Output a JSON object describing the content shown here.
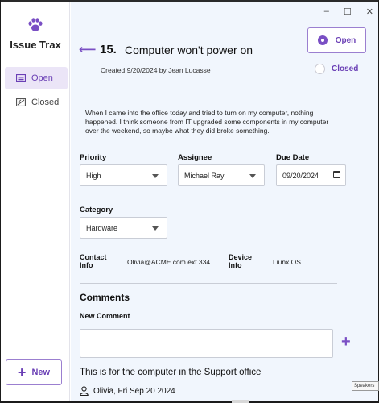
{
  "app": {
    "name": "Issue Trax"
  },
  "window_controls": {
    "minimize": "–",
    "maximize": "☐",
    "close": "✕"
  },
  "sidebar": {
    "items": [
      {
        "label": "Open",
        "icon": "inbox-icon",
        "active": true
      },
      {
        "label": "Closed",
        "icon": "closed-box-icon",
        "active": false
      }
    ],
    "new_button": {
      "icon": "+",
      "label": "New"
    }
  },
  "issue": {
    "number": "15.",
    "title": "Computer won't power on",
    "created": "Created 9/20/2024 by Jean Lucasse",
    "status_options": {
      "open": "Open",
      "closed": "Closed",
      "selected": "Open"
    },
    "description": "When I came into the office today and tried to turn on my computer, nothing happened. I think someone from IT upgraded some components in my computer over the weekend, so maybe what they did broke something.",
    "priority": {
      "label": "Priority",
      "value": "High"
    },
    "assignee": {
      "label": "Assignee",
      "value": "Michael Ray"
    },
    "due_date": {
      "label": "Due Date",
      "value": "09/20/2024"
    },
    "category": {
      "label": "Category",
      "value": "Hardware"
    },
    "contact_info": {
      "label_line1": "Contact",
      "label_line2": "Info",
      "value": "Olivia@ACME.com ext.334"
    },
    "device_info": {
      "label_line1": "Device",
      "label_line2": "Info",
      "value": "Liunx OS"
    }
  },
  "comments": {
    "heading": "Comments",
    "new_comment_label": "New Comment",
    "new_comment_value": "",
    "add_icon": "+",
    "items": [
      {
        "text": "This is for the computer in the Support office",
        "author_date": "Olivia, Fri Sep 20 2024"
      }
    ]
  },
  "tooltip": {
    "text": "Speakers"
  },
  "colors": {
    "accent": "#7a4fc4",
    "main_bg": "#f1f6fd",
    "active_nav_bg": "#ebe5f7"
  }
}
